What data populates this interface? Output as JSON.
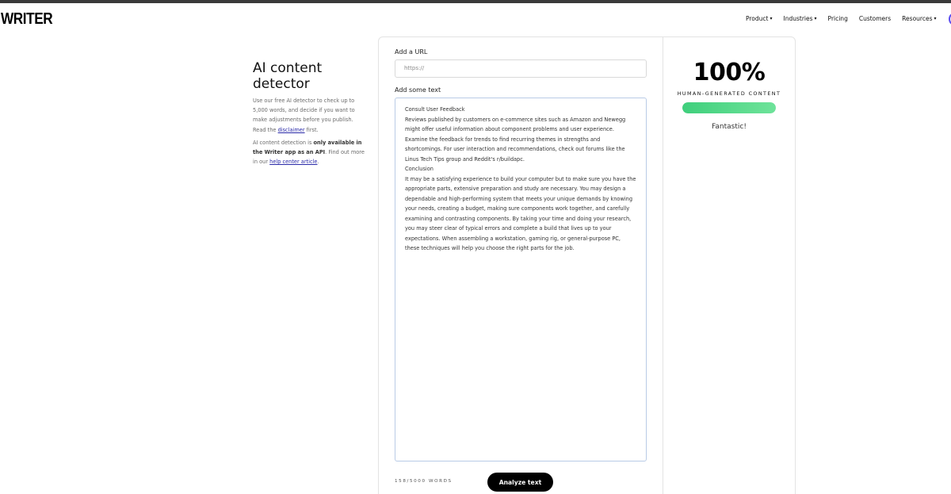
{
  "brand": {
    "logo": "WRITER"
  },
  "nav": {
    "items": [
      {
        "label": "Product",
        "caret": "▾"
      },
      {
        "label": "Industries",
        "caret": "▾"
      },
      {
        "label": "Pricing",
        "caret": ""
      },
      {
        "label": "Customers",
        "caret": ""
      },
      {
        "label": "Resources",
        "caret": "▾"
      }
    ]
  },
  "intro": {
    "title": "AI content detector",
    "p1_before": "Use our free AI detector to check up to 5,000 words, and decide if you want to make adjustments before you publish. Read the ",
    "p1_link": "disclaimer",
    "p1_after": " first.",
    "p2_before": "AI content detection is ",
    "p2_bold": "only available in the Writer app as an API",
    "p2_mid": ". Find out more in our ",
    "p2_link": "help center article",
    "p2_after": "."
  },
  "form": {
    "url_label": "Add a URL",
    "url_placeholder": "https://",
    "text_label": "Add some text",
    "text_lines": [
      "Consult User Feedback",
      "Reviews published by customers on e-commerce sites such as Amazon and Newegg might offer useful information about component problems and user experience. Examine the feedback for trends to find recurring themes in strengths and shortcomings. For user interaction and recommendations, check out forums like the Linus Tech Tips group and Reddit's r/buildapc.",
      "Conclusion",
      "It may be a satisfying experience to build your computer but to make sure you have the appropriate parts, extensive preparation and study are necessary. You may design a dependable and high-performing system that meets your unique demands by knowing your needs, creating a budget, making sure components work together, and carefully examining and contrasting components. By taking your time and doing your research, you may steer clear of typical errors and complete a build that lives up to your expectations. When assembling a workstation, gaming rig, or general-purpose PC, these techniques will help you choose the right parts for the job."
    ],
    "word_count": "158/5000 WORDS",
    "analyze_label": "Analyze text"
  },
  "result": {
    "score": "100%",
    "label": "HUMAN-GENERATED CONTENT",
    "bar_fraction": 1.0,
    "bar_color": "#3fcf7c",
    "verdict": "Fantastic!"
  }
}
